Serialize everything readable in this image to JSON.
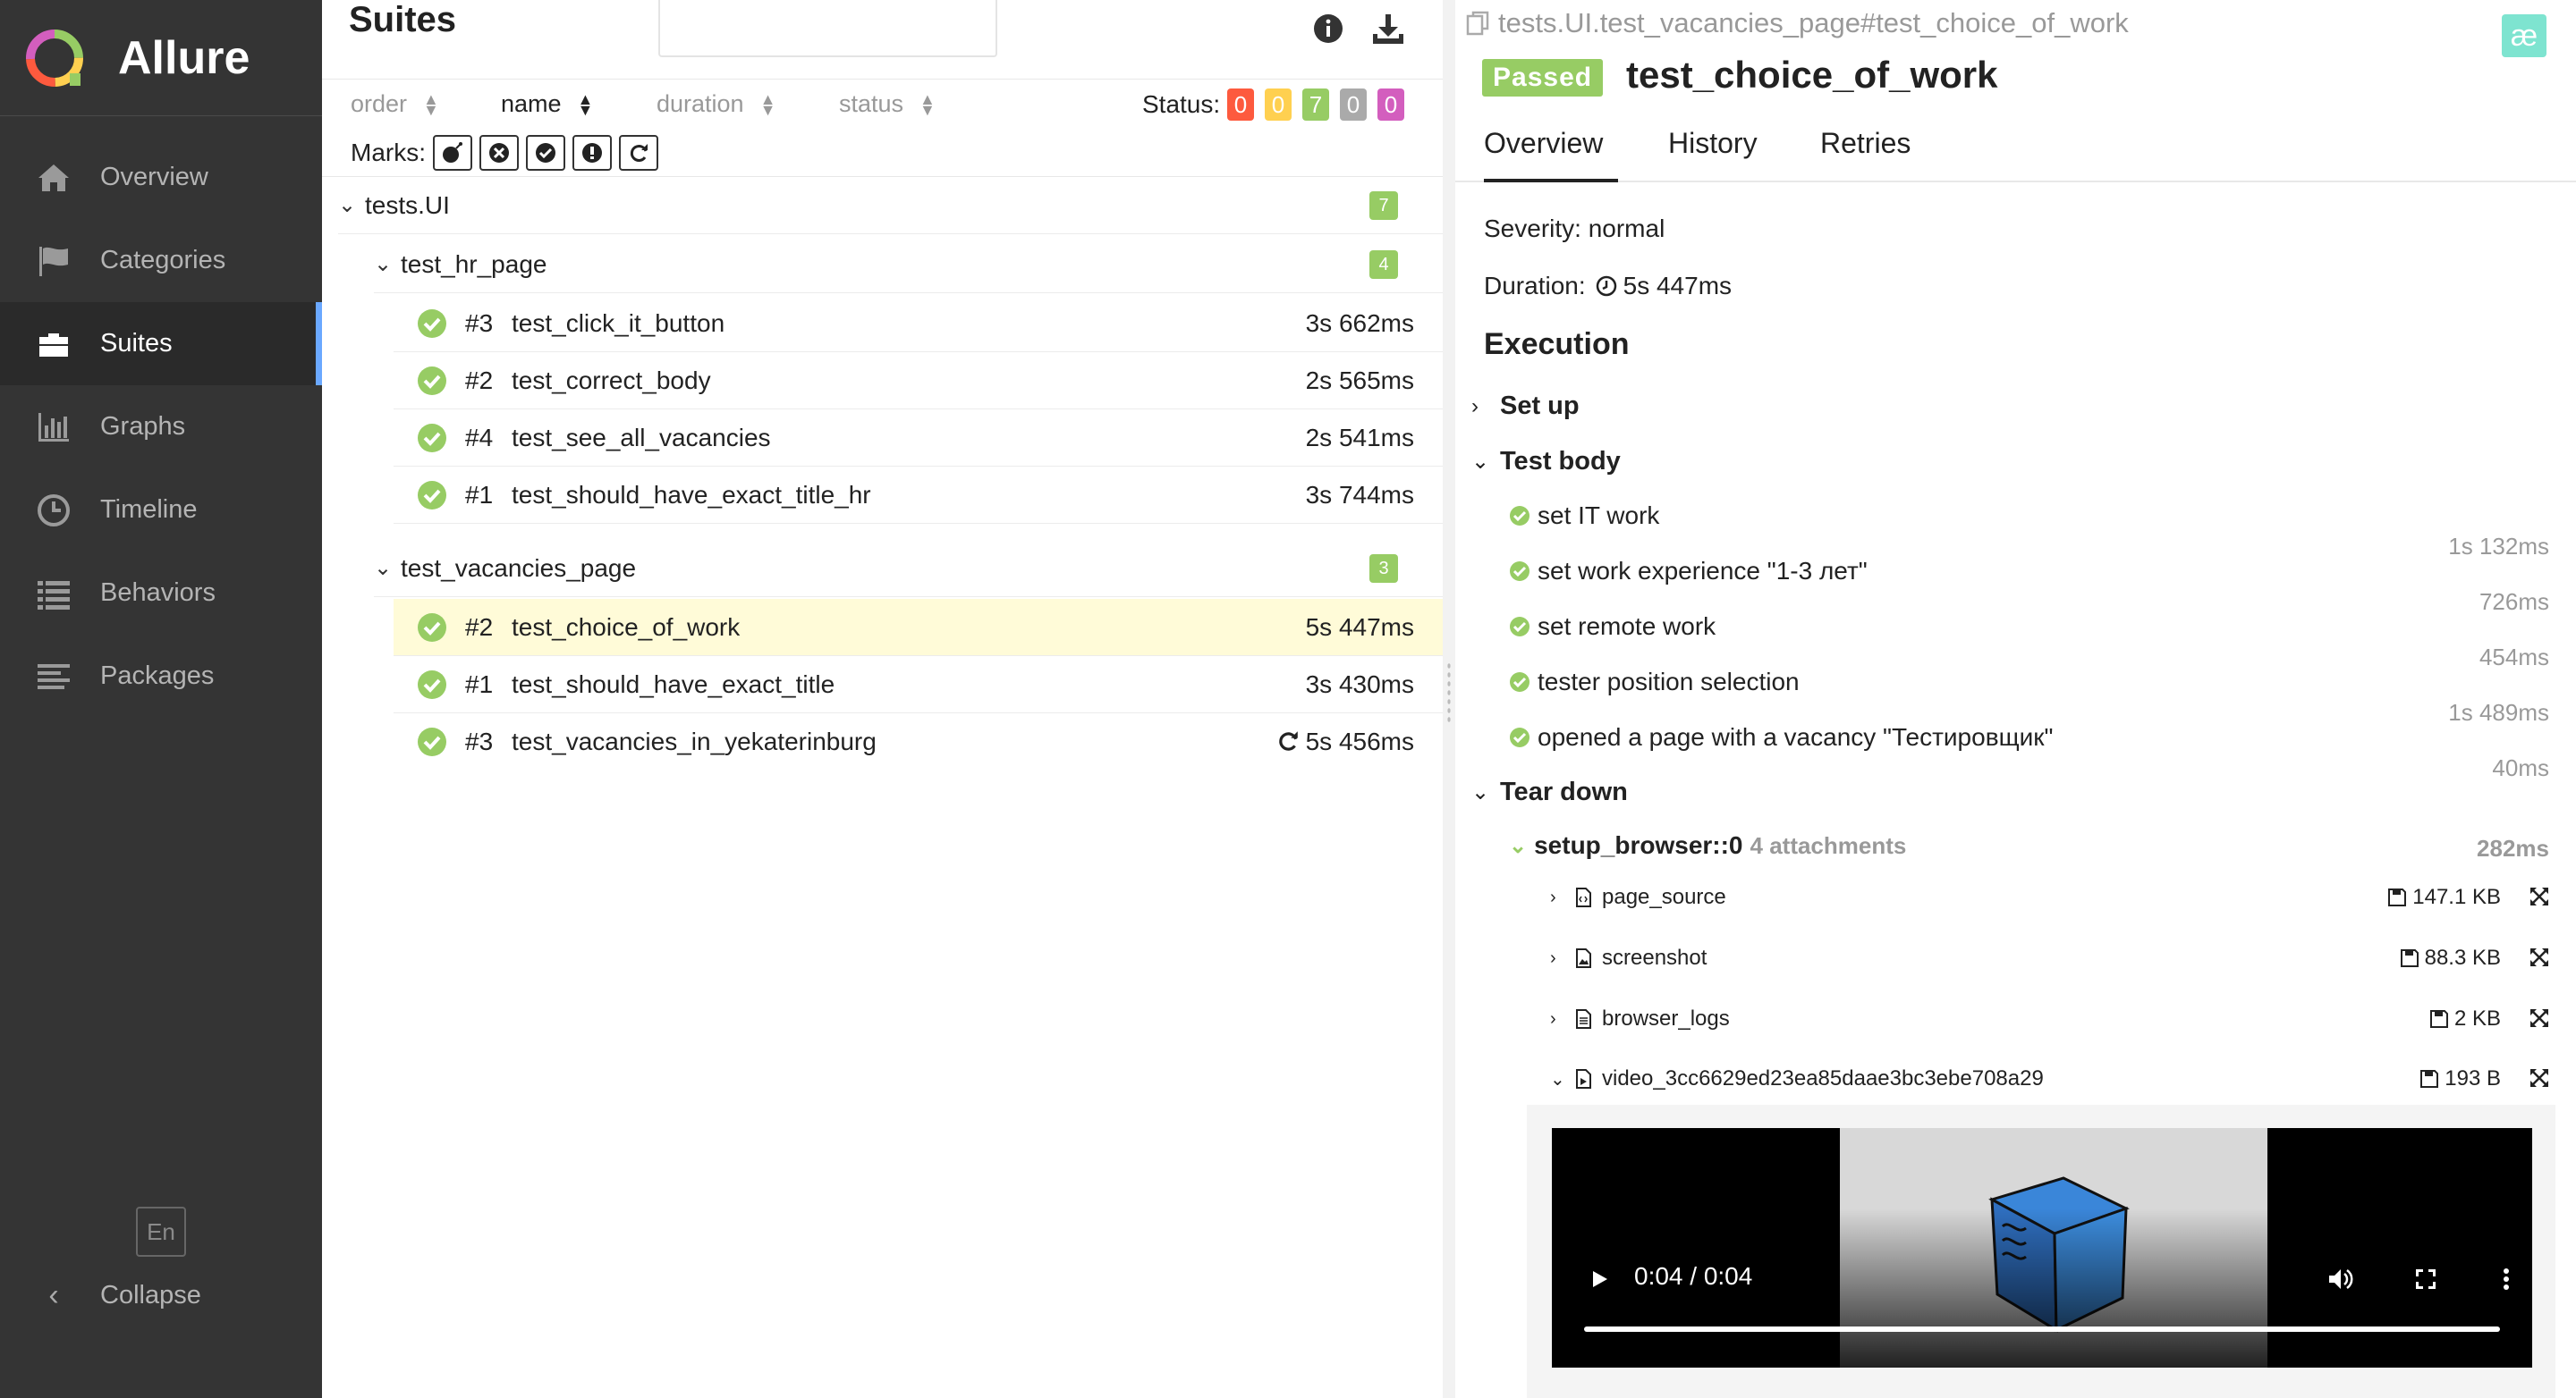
{
  "sidebar": {
    "brand": "Allure",
    "items": [
      {
        "label": "Overview",
        "icon": "home-icon"
      },
      {
        "label": "Categories",
        "icon": "flag-icon"
      },
      {
        "label": "Suites",
        "icon": "briefcase-icon",
        "active": true
      },
      {
        "label": "Graphs",
        "icon": "bar-chart-icon"
      },
      {
        "label": "Timeline",
        "icon": "clock-icon"
      },
      {
        "label": "Behaviors",
        "icon": "list-icon"
      },
      {
        "label": "Packages",
        "icon": "align-left-icon"
      }
    ],
    "language": "En",
    "collapse": "Collapse"
  },
  "suites": {
    "title": "Suites",
    "search_value": "",
    "sort": {
      "order": "order",
      "name": "name",
      "duration": "duration",
      "status": "status"
    },
    "status_label": "Status:",
    "status_counts": [
      {
        "value": "0",
        "color": "#fd5a3e"
      },
      {
        "value": "0",
        "color": "#ffd050"
      },
      {
        "value": "7",
        "color": "#97cc64"
      },
      {
        "value": "0",
        "color": "#aaaaaa"
      },
      {
        "value": "0",
        "color": "#d35ebe"
      }
    ],
    "marks_label": "Marks:",
    "tree": {
      "root": {
        "name": "tests.UI",
        "count": "7"
      },
      "groups": [
        {
          "name": "test_hr_page",
          "count": "4",
          "tests": [
            {
              "num": "#3",
              "name": "test_click_it_button",
              "duration": "3s 662ms"
            },
            {
              "num": "#2",
              "name": "test_correct_body",
              "duration": "2s 565ms"
            },
            {
              "num": "#4",
              "name": "test_see_all_vacancies",
              "duration": "2s 541ms"
            },
            {
              "num": "#1",
              "name": "test_should_have_exact_title_hr",
              "duration": "3s 744ms"
            }
          ]
        },
        {
          "name": "test_vacancies_page",
          "count": "3",
          "tests": [
            {
              "num": "#2",
              "name": "test_choice_of_work",
              "duration": "5s 447ms",
              "selected": true
            },
            {
              "num": "#1",
              "name": "test_should_have_exact_title",
              "duration": "3s 430ms"
            },
            {
              "num": "#3",
              "name": "test_vacancies_in_yekaterinburg",
              "duration": "5s 456ms",
              "retried": true
            }
          ]
        }
      ]
    }
  },
  "detail": {
    "breadcrumb": "tests.UI.test_vacancies_page#test_choice_of_work",
    "ae": "æ",
    "status": "Passed",
    "title": "test_choice_of_work",
    "tabs": [
      "Overview",
      "History",
      "Retries"
    ],
    "severity": "Severity: normal",
    "duration_label": "Duration:",
    "duration": "5s 447ms",
    "execution": "Execution",
    "setup": "Set up",
    "test_body": "Test body",
    "steps": [
      {
        "name": "set IT work",
        "duration": "1s 132ms"
      },
      {
        "name": "set work experience \"1-3 лет\"",
        "duration": "726ms"
      },
      {
        "name": "set remote work",
        "duration": "454ms"
      },
      {
        "name": "tester position selection",
        "duration": "1s 489ms"
      },
      {
        "name": "opened a page with a vacancy \"Тестировщик\"",
        "duration": "40ms"
      }
    ],
    "teardown": "Tear down",
    "fixture": {
      "name": "setup_browser::0",
      "attachments": "4 attachments",
      "duration": "282ms"
    },
    "attachments": [
      {
        "name": "page_source",
        "size": "147.1 KB"
      },
      {
        "name": "screenshot",
        "size": "88.3 KB"
      },
      {
        "name": "browser_logs",
        "size": "2 KB"
      },
      {
        "name": "video_3cc6629ed23ea85daae3bc3ebe708a29",
        "size": "193 B"
      }
    ],
    "video": {
      "time": "0:04 / 0:04",
      "progress": 1.0
    }
  }
}
